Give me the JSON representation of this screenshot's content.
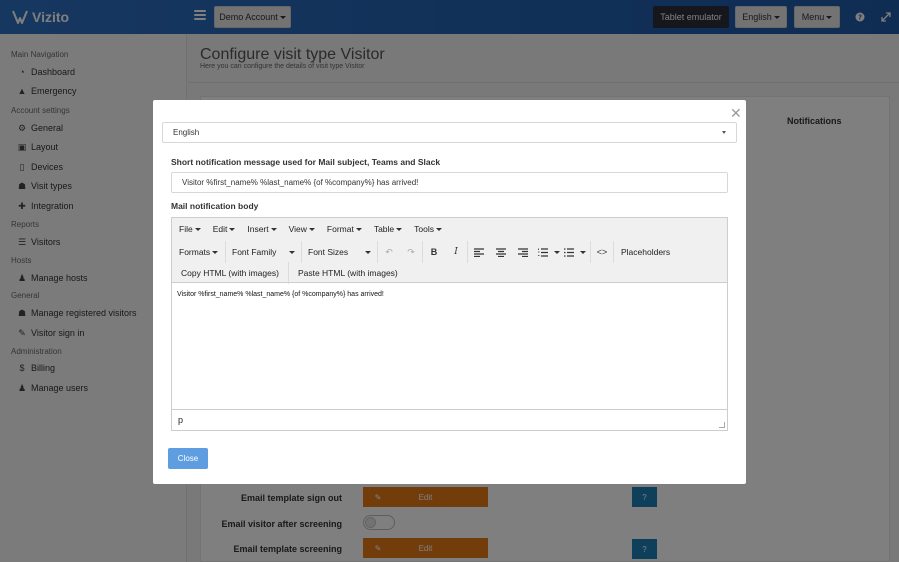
{
  "app": {
    "name": "Vizito"
  },
  "topbar": {
    "account_label": "Demo Account",
    "tablet_label": "Tablet emulator",
    "language_label": "English",
    "menu_label": "Menu",
    "help_icon": "question-circle-icon",
    "expand_icon": "expand-icon"
  },
  "sidebar": {
    "main_nav": "Main Navigation",
    "dashboard": "Dashboard",
    "emergency": "Emergency",
    "account_settings": "Account settings",
    "general": "General",
    "layout": "Layout",
    "devices": "Devices",
    "visit_types": "Visit types",
    "integration": "Integration",
    "reports": "Reports",
    "visitors": "Visitors",
    "hosts": "Hosts",
    "manage_hosts": "Manage hosts",
    "general2": "General",
    "manage_registered": "Manage registered visitors",
    "visitor_sign_in": "Visitor sign in",
    "administration": "Administration",
    "billing": "Billing",
    "manage_users": "Manage users"
  },
  "page": {
    "title": "Configure visit type Visitor",
    "subtitle": "Here you can configure the details of visit type Visitor",
    "notifications_header": "Notifications",
    "rows": [
      {
        "label": "Email template sign out",
        "edit": "Edit",
        "help": "?"
      },
      {
        "label": "Email visitor after screening"
      },
      {
        "label": "Email template screening",
        "edit": "Edit",
        "help": "?"
      }
    ]
  },
  "modal": {
    "language": "English",
    "short_label": "Short notification message used for Mail subject, Teams and Slack",
    "short_value": "Visitor %first_name% %last_name% {of %company%} has arrived!",
    "body_label": "Mail notification body",
    "menus": [
      "File",
      "Edit",
      "Insert",
      "View",
      "Format",
      "Table",
      "Tools"
    ],
    "formats": "Formats",
    "font_family": "Font Family",
    "font_sizes": "Font Sizes",
    "placeholders": "Placeholders",
    "copy_html": "Copy HTML (with images)",
    "paste_html": "Paste HTML (with images)",
    "body_text": "Visitor %first_name% %last_name% {of %company%} has arrived!",
    "status_path": "p",
    "close_label": "Close"
  },
  "colors": {
    "topbar": "#2463b3",
    "edit_orange": "#e67a17",
    "help_blue": "#1f80b6",
    "close_blue": "#5e9ee0"
  }
}
